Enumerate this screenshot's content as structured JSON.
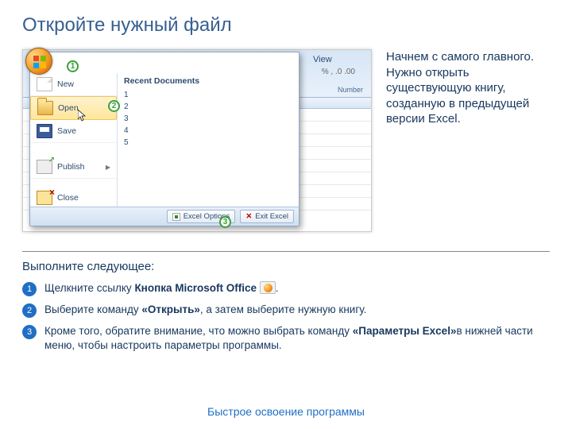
{
  "title": "Откройте нужный файл",
  "sidebox": "Начнем с самого главного. Нужно открыть существующую книгу, созданную в предыдущей версии Excel.",
  "instructions_title": "Выполните следующее:",
  "footer": "Быстрое освоение программы",
  "ribbon": {
    "tab": "View",
    "group": "Number",
    "numfmt": "% , .0 .00"
  },
  "office_menu": {
    "recent_header": "Recent Documents",
    "items": {
      "new": "New",
      "open": "Open",
      "save": "Save",
      "publish": "Publish",
      "close": "Close"
    },
    "recent": [
      "1",
      "2",
      "3",
      "4",
      "5"
    ],
    "bottom": {
      "options": "Excel Options",
      "exit": "Exit Excel"
    }
  },
  "callouts": {
    "c1": "1",
    "c2": "2",
    "c3": "3"
  },
  "steps": [
    {
      "num": "1",
      "pre": "Щелкните ссылку ",
      "bold": "Кнопка Microsoft Office",
      "post": ".",
      "icon": true
    },
    {
      "num": "2",
      "pre": "Выберите команду ",
      "bold": "«Открыть»",
      "post": ", а затем выберите нужную книгу.",
      "icon": false
    },
    {
      "num": "3",
      "pre": "Кроме того, обратите внимание, что можно выбрать команду ",
      "bold": "«Параметры Excel»",
      "post": "в нижней части меню, чтобы настроить параметры программы.",
      "icon": false
    }
  ]
}
